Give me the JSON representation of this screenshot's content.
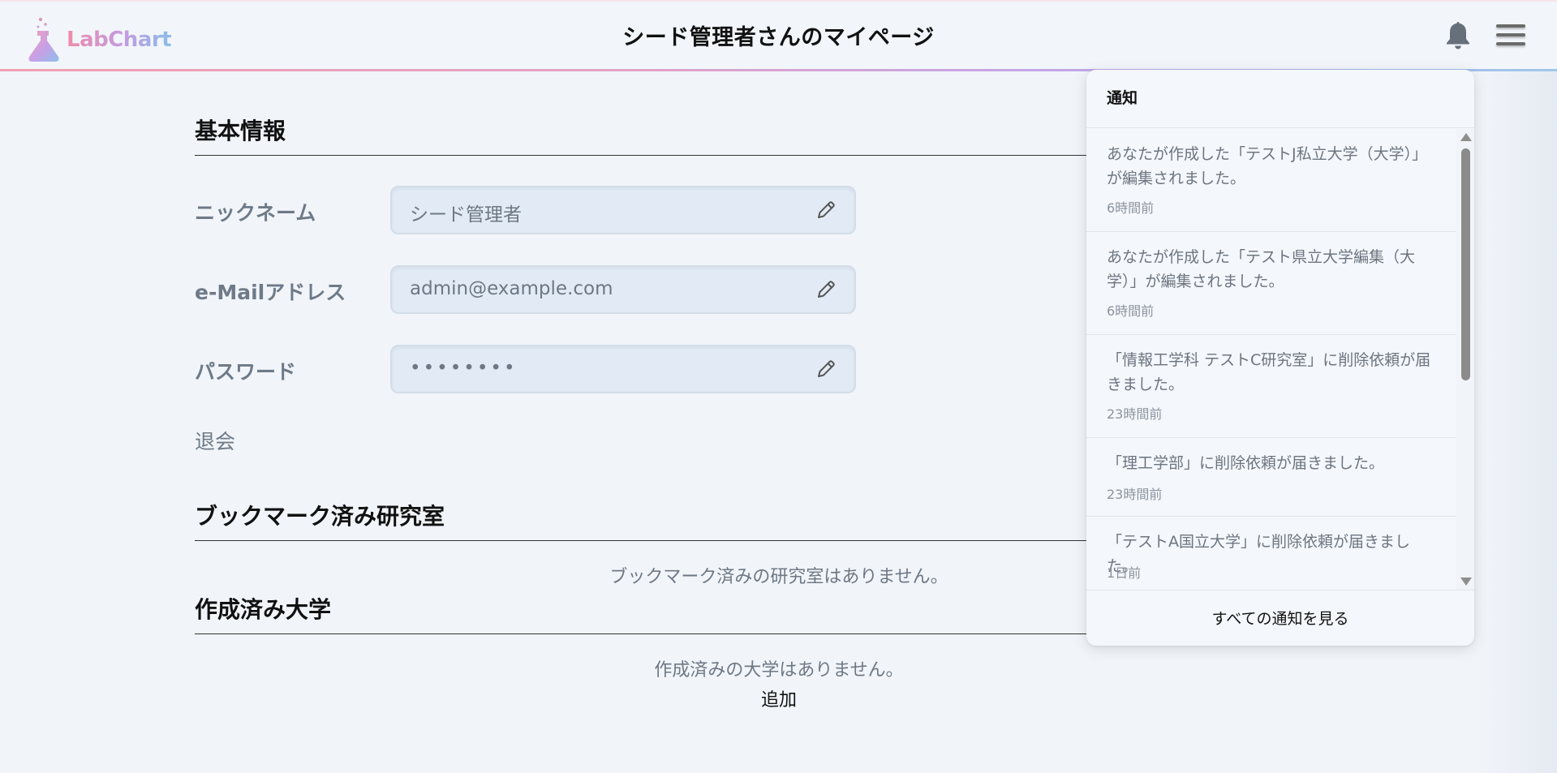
{
  "header": {
    "logo_text": "LabChart",
    "title": "シード管理者さんのマイページ",
    "bell_icon": "bell-icon",
    "menu_icon": "hamburger-menu-icon"
  },
  "basic_info": {
    "title": "基本情報",
    "fields": [
      {
        "label": "ニックネーム",
        "value": "シード管理者",
        "edit_icon": "pencil-icon"
      },
      {
        "label": "e-Mailアドレス",
        "value": "admin@example.com",
        "edit_icon": "pencil-icon"
      },
      {
        "label": "パスワード",
        "value": "••••••••",
        "edit_icon": "pencil-icon"
      }
    ],
    "withdraw_label": "退会"
  },
  "bookmarks": {
    "title": "ブックマーク済み研究室",
    "empty_message": "ブックマーク済みの研究室はありません。"
  },
  "universities": {
    "title": "作成済み大学",
    "empty_message": "作成済みの大学はありません。",
    "add_label": "追加"
  },
  "notifications": {
    "title": "通知",
    "items": [
      {
        "message": "あなたが作成した「テストJ私立大学（大学）」が編集されました。",
        "time": "6時間前"
      },
      {
        "message": "あなたが作成した「テスト県立大学編集（大学）」が編集されました。",
        "time": "6時間前"
      },
      {
        "message": "「情報工学科 テストC研究室」に削除依頼が届きました。",
        "time": "23時間前"
      },
      {
        "message": "「理工学部」に削除依頼が届きました。",
        "time": "23時間前"
      },
      {
        "message": "「テストA国立大学」に削除依頼が届きました。",
        "time": "1日前"
      }
    ],
    "view_all_label": "すべての通知を見る"
  },
  "colors": {
    "background": "#f1f5fa",
    "field_background": "#e2ebf5",
    "label_gray": "#6e7a88",
    "accent_pink": "#f08ca9",
    "accent_purple": "#c39be2",
    "accent_blue": "#8cbde8"
  }
}
